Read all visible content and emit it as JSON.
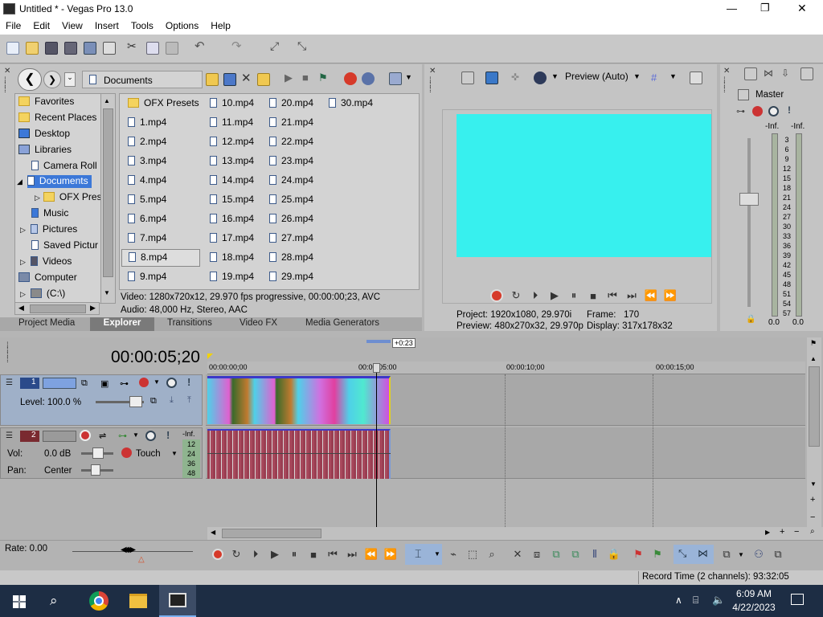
{
  "window": {
    "title": "Untitled * - Vegas Pro 13.0",
    "min": "—",
    "max": "❐",
    "close": "✕"
  },
  "menu": [
    "File",
    "Edit",
    "View",
    "Insert",
    "Tools",
    "Options",
    "Help"
  ],
  "explorer": {
    "path": "Documents",
    "tree": [
      {
        "label": "Favorites",
        "indent": 0
      },
      {
        "label": "Recent Places",
        "indent": 0
      },
      {
        "label": "Desktop",
        "indent": 0
      },
      {
        "label": "Libraries",
        "indent": 0
      },
      {
        "label": "Camera Roll",
        "indent": 1
      },
      {
        "label": "Documents",
        "indent": 1
      },
      {
        "label": "OFX Pres",
        "indent": 2
      },
      {
        "label": "Music",
        "indent": 1
      },
      {
        "label": "Pictures",
        "indent": 1
      },
      {
        "label": "Saved Pictur",
        "indent": 1
      },
      {
        "label": "Videos",
        "indent": 1
      },
      {
        "label": "Computer",
        "indent": 0
      },
      {
        "label": "(C:\\)",
        "indent": 1
      }
    ],
    "files": [
      "OFX Presets",
      "1.mp4",
      "2.mp4",
      "3.mp4",
      "4.mp4",
      "5.mp4",
      "6.mp4",
      "7.mp4",
      "8.mp4",
      "9.mp4",
      "10.mp4",
      "11.mp4",
      "12.mp4",
      "13.mp4",
      "14.mp4",
      "15.mp4",
      "16.mp4",
      "17.mp4",
      "18.mp4",
      "19.mp4",
      "20.mp4",
      "21.mp4",
      "22.mp4",
      "23.mp4",
      "24.mp4",
      "25.mp4",
      "26.mp4",
      "27.mp4",
      "28.mp4",
      "29.mp4",
      "30.mp4"
    ],
    "info_video": "Video: 1280x720x12, 29.970 fps progressive, 00:00:00;23, AVC",
    "info_audio": "Audio: 48,000 Hz, Stereo, AAC",
    "tabs": [
      "Project Media",
      "Explorer",
      "Transitions",
      "Video FX",
      "Media Generators"
    ]
  },
  "preview": {
    "mode": "Preview (Auto)",
    "project_label": "Project:",
    "project_value": "1920x1080, 29.970i",
    "preview_label": "Preview:",
    "preview_value": "480x270x32, 29.970p",
    "frame_label": "Frame:",
    "frame_value": "170",
    "display_label": "Display:",
    "display_value": "317x178x32",
    "screen_color": "#37f0ee"
  },
  "master": {
    "title": "Master",
    "inf_l": "-Inf.",
    "inf_r": "-Inf.",
    "scale": [
      "3",
      "6",
      "9",
      "12",
      "15",
      "18",
      "21",
      "24",
      "27",
      "30",
      "33",
      "36",
      "39",
      "42",
      "45",
      "48",
      "51",
      "54",
      "57"
    ],
    "level_l": "0.0",
    "level_r": "0.0"
  },
  "timeline": {
    "timecode": "00:00:05;20",
    "offset": "+0:23",
    "ruler": [
      "00:00:00;00",
      "00:00:05:00",
      "00:00:10;00",
      "00:00:15;00"
    ],
    "video_track": {
      "num": "1",
      "level": "Level: 100.0 %"
    },
    "audio_track": {
      "num": "2",
      "vol_label": "Vol:",
      "vol": "0.0 dB",
      "pan_label": "Pan:",
      "pan": "Center",
      "touch": "Touch",
      "inf": "-Inf.",
      "meter": [
        "12",
        "24",
        "36",
        "48"
      ]
    },
    "rate": "Rate: 0.00"
  },
  "status": {
    "record": "Record Time (2 channels): 93:32:05"
  },
  "taskbar": {
    "time": "6:09 AM",
    "date": "4/22/2023"
  }
}
